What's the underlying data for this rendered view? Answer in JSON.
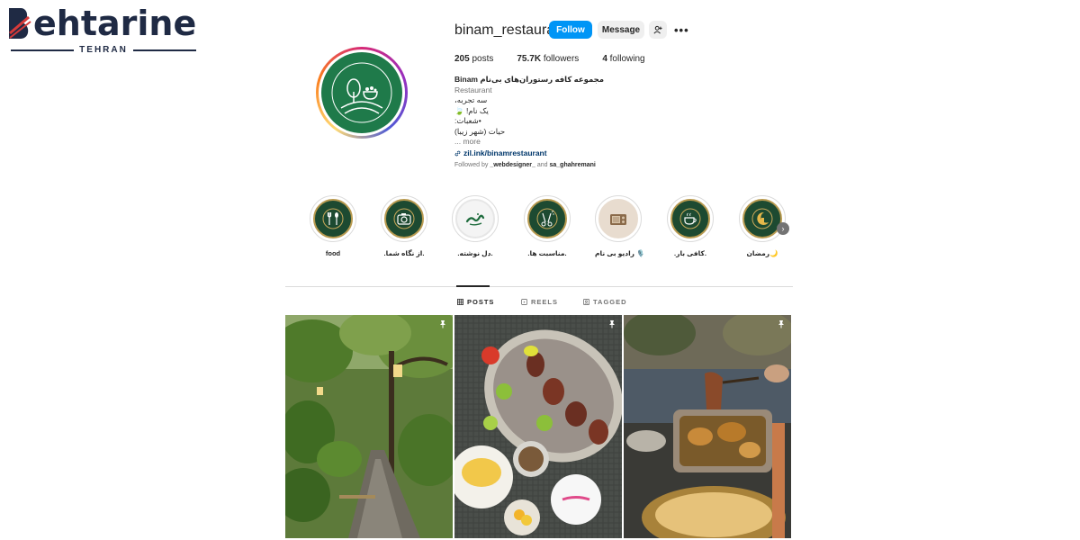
{
  "watermark": {
    "brand": "ehtarine",
    "city": "TEHRAN"
  },
  "profile": {
    "username": "binam_restaurant",
    "follow_label": "Follow",
    "message_label": "Message",
    "more_label": "•••",
    "stats": {
      "posts_count": "205",
      "posts_label": "posts",
      "followers_count": "75.7K",
      "followers_label": "followers",
      "following_count": "4",
      "following_label": "following"
    },
    "bio": {
      "name": "Binam مجموعه کافه رستوران‌های بی‌نام",
      "category": "Restaurant",
      "line1": "سه تجربه،",
      "line2": "یک نام! 🍃",
      "line3": "•شعبات:",
      "line4": "حیات (شهر زیبا)",
      "more": "... more",
      "link": "zil.ink/binamrestaurant"
    },
    "followed_by_prefix": "Followed by",
    "followed_by_user1": "_webdesigner_",
    "followed_by_and": "and",
    "followed_by_user2": "sa_ghahremani"
  },
  "highlights": [
    {
      "label": "food"
    },
    {
      "label": ".از نگاه شما."
    },
    {
      "label": ".دل نوشته."
    },
    {
      "label": ".مناسبت ها."
    },
    {
      "label": "رادیو بی نام 🎙️"
    },
    {
      "label": ".کافی بار."
    },
    {
      "label": "رمضان🌙"
    }
  ],
  "tabs": [
    {
      "label": "POSTS",
      "active": true
    },
    {
      "label": "REELS",
      "active": false
    },
    {
      "label": "TAGGED",
      "active": false
    }
  ],
  "posts": [
    {
      "scene": "garden path with lamps",
      "pinned": true
    },
    {
      "scene": "kebab platter with rice",
      "pinned": true
    },
    {
      "scene": "copper pot and stew",
      "pinned": true
    }
  ],
  "colors": {
    "accent": "#0095f6",
    "link": "#00376b",
    "secondary_text": "#737373",
    "divider": "#dbdbdb"
  }
}
